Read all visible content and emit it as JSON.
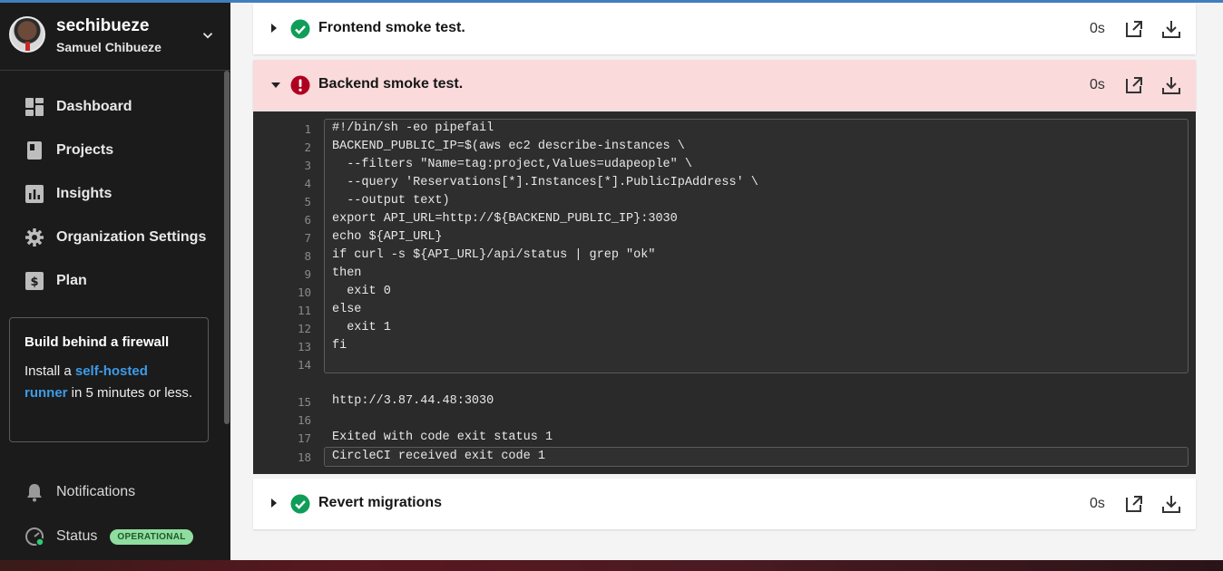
{
  "user": {
    "username": "sechibueze",
    "full_name": "Samuel Chibueze"
  },
  "nav": [
    {
      "label": "Dashboard",
      "icon": "dashboard-icon"
    },
    {
      "label": "Projects",
      "icon": "projects-icon"
    },
    {
      "label": "Insights",
      "icon": "insights-icon"
    },
    {
      "label": "Organization Settings",
      "icon": "gear-icon"
    },
    {
      "label": "Plan",
      "icon": "dollar-icon"
    }
  ],
  "promo": {
    "title": "Build behind a firewall",
    "text_before": "Install a ",
    "link": "self-hosted runner",
    "text_after": " in 5 minutes or less."
  },
  "bottom": {
    "notifications": "Notifications",
    "status": "Status",
    "status_badge": "OPERATIONAL"
  },
  "steps": [
    {
      "title": "Frontend smoke test.",
      "duration": "0s",
      "status": "success"
    },
    {
      "title": "Backend smoke test.",
      "duration": "0s",
      "status": "failed"
    },
    {
      "title": "Revert migrations",
      "duration": "0s",
      "status": "success"
    }
  ],
  "console": {
    "script_lines": [
      {
        "n": "1",
        "text": "#!/bin/sh -eo pipefail"
      },
      {
        "n": "2",
        "text": "BACKEND_PUBLIC_IP=$(aws ec2 describe-instances \\"
      },
      {
        "n": "3",
        "text": "  --filters \"Name=tag:project,Values=udapeople\" \\"
      },
      {
        "n": "4",
        "text": "  --query 'Reservations[*].Instances[*].PublicIpAddress' \\"
      },
      {
        "n": "5",
        "text": "  --output text)"
      },
      {
        "n": "6",
        "text": "export API_URL=http://${BACKEND_PUBLIC_IP}:3030"
      },
      {
        "n": "7",
        "text": "echo ${API_URL}"
      },
      {
        "n": "8",
        "text": "if curl -s ${API_URL}/api/status | grep \"ok\""
      },
      {
        "n": "9",
        "text": "then"
      },
      {
        "n": "10",
        "text": "  exit 0"
      },
      {
        "n": "11",
        "text": "else"
      },
      {
        "n": "12",
        "text": "  exit 1"
      },
      {
        "n": "13",
        "text": "fi"
      },
      {
        "n": "14",
        "text": ""
      }
    ],
    "output_lines": [
      {
        "n": "15",
        "text": "http://3.87.44.48:3030"
      },
      {
        "n": "16",
        "text": ""
      },
      {
        "n": "17",
        "text": "Exited with code exit status 1"
      },
      {
        "n": "18",
        "text": "CircleCI received exit code 1"
      }
    ]
  },
  "colors": {
    "accent_link": "#3d9be9",
    "success": "#0f9d58",
    "failed": "#b00020",
    "failed_bg": "#fadadb",
    "badge_bg": "#8fdd9f"
  }
}
